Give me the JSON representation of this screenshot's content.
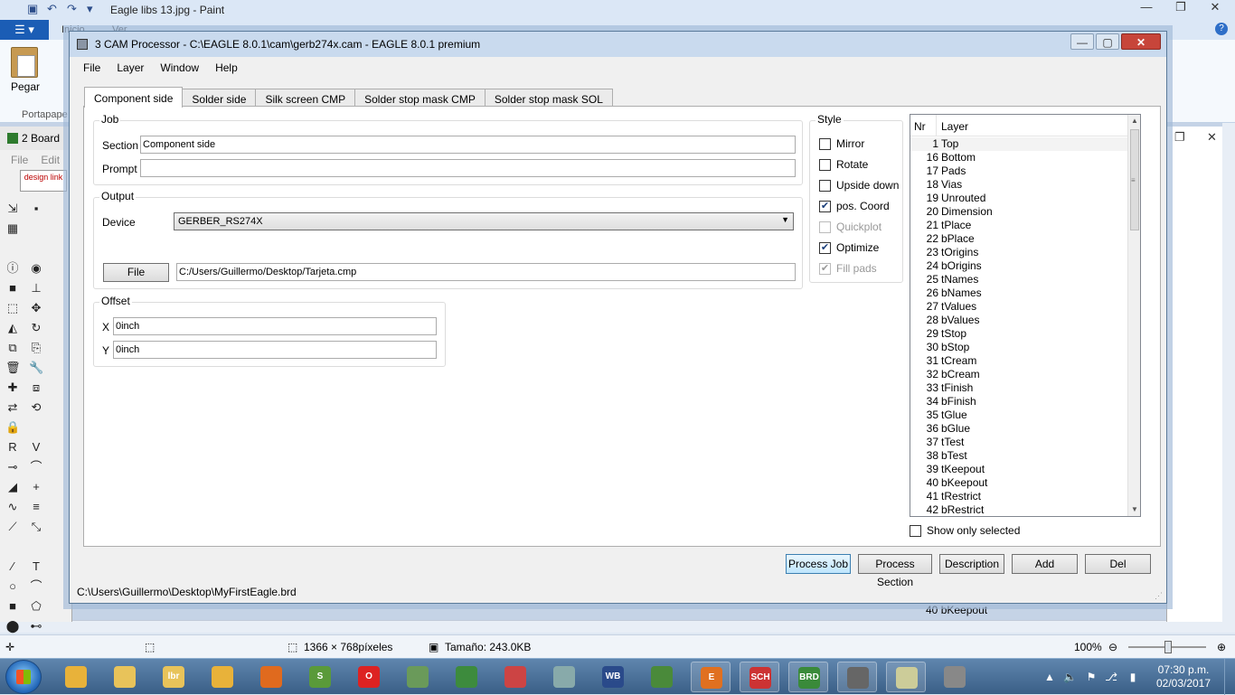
{
  "paint": {
    "title": "Eagle libs 13.jpg - Paint",
    "tabs": [
      "Inicio",
      "Ver"
    ],
    "paste_label": "Pegar",
    "clipboard_label": "Portapape",
    "status": {
      "dimensions": "1366 × 768píxeles",
      "size": "Tamaño: 243.0KB",
      "zoom": "100%"
    }
  },
  "board": {
    "title": "2 Board",
    "menu": [
      "File",
      "Edit"
    ],
    "design_link": "design link",
    "bottom_row_nr": "40",
    "bottom_row_name": "bKeepout"
  },
  "cam": {
    "title": "3 CAM Processor - C:\\EAGLE 8.0.1\\cam\\gerb274x.cam - EAGLE 8.0.1 premium",
    "menu": [
      "File",
      "Layer",
      "Window",
      "Help"
    ],
    "tabs": [
      {
        "label": "Component side",
        "active": true
      },
      {
        "label": "Solder side",
        "active": false
      },
      {
        "label": "Silk screen CMP",
        "active": false
      },
      {
        "label": "Solder stop mask CMP",
        "active": false
      },
      {
        "label": "Solder stop mask SOL",
        "active": false
      }
    ],
    "job": {
      "title": "Job",
      "section_label": "Section",
      "section_value": "Component side",
      "prompt_label": "Prompt",
      "prompt_value": ""
    },
    "output": {
      "title": "Output",
      "device_label": "Device",
      "device_value": "GERBER_RS274X",
      "file_button": "File",
      "file_value": "C:/Users/Guillermo/Desktop/Tarjeta.cmp"
    },
    "offset": {
      "title": "Offset",
      "x_label": "X",
      "x_value": "0inch",
      "y_label": "Y",
      "y_value": "0inch"
    },
    "style": {
      "title": "Style",
      "options": [
        {
          "label": "Mirror",
          "checked": false,
          "disabled": false
        },
        {
          "label": "Rotate",
          "checked": false,
          "disabled": false
        },
        {
          "label": "Upside down",
          "checked": false,
          "disabled": false
        },
        {
          "label": "pos. Coord",
          "checked": true,
          "disabled": false
        },
        {
          "label": "Quickplot",
          "checked": false,
          "disabled": true
        },
        {
          "label": "Optimize",
          "checked": true,
          "disabled": false
        },
        {
          "label": "Fill pads",
          "checked": true,
          "disabled": true
        }
      ]
    },
    "layers": {
      "col_nr": "Nr",
      "col_layer": "Layer",
      "rows": [
        {
          "nr": "1",
          "name": "Top"
        },
        {
          "nr": "16",
          "name": "Bottom"
        },
        {
          "nr": "17",
          "name": "Pads"
        },
        {
          "nr": "18",
          "name": "Vias"
        },
        {
          "nr": "19",
          "name": "Unrouted"
        },
        {
          "nr": "20",
          "name": "Dimension"
        },
        {
          "nr": "21",
          "name": "tPlace"
        },
        {
          "nr": "22",
          "name": "bPlace"
        },
        {
          "nr": "23",
          "name": "tOrigins"
        },
        {
          "nr": "24",
          "name": "bOrigins"
        },
        {
          "nr": "25",
          "name": "tNames"
        },
        {
          "nr": "26",
          "name": "bNames"
        },
        {
          "nr": "27",
          "name": "tValues"
        },
        {
          "nr": "28",
          "name": "bValues"
        },
        {
          "nr": "29",
          "name": "tStop"
        },
        {
          "nr": "30",
          "name": "bStop"
        },
        {
          "nr": "31",
          "name": "tCream"
        },
        {
          "nr": "32",
          "name": "bCream"
        },
        {
          "nr": "33",
          "name": "tFinish"
        },
        {
          "nr": "34",
          "name": "bFinish"
        },
        {
          "nr": "35",
          "name": "tGlue"
        },
        {
          "nr": "36",
          "name": "bGlue"
        },
        {
          "nr": "37",
          "name": "tTest"
        },
        {
          "nr": "38",
          "name": "bTest"
        },
        {
          "nr": "39",
          "name": "tKeepout"
        },
        {
          "nr": "40",
          "name": "bKeepout"
        },
        {
          "nr": "41",
          "name": "tRestrict"
        },
        {
          "nr": "42",
          "name": "bRestrict"
        }
      ],
      "show_only_selected": "Show only selected"
    },
    "buttons": {
      "process_job": "Process Job",
      "process_section": "Process Section",
      "description": "Description",
      "add": "Add",
      "del": "Del"
    },
    "status_path": "C:\\Users\\Guillermo\\Desktop\\MyFirstEagle.brd"
  },
  "taskbar": {
    "apps": [
      "Downloads",
      "Folder",
      "lbr",
      "Downloads",
      "Firefox",
      "Sharp",
      "Opera",
      "Game",
      "Chrome",
      "App",
      "Snipping",
      "WB",
      "j...",
      "E",
      "SCH",
      "BRD",
      "Camera",
      "Paint",
      "Route"
    ],
    "clock_time": "07:30 p.m.",
    "clock_date": "02/03/2017"
  },
  "colors": {
    "cam_titlebar": "#c9daee",
    "taskbar": "#3a5f86",
    "close_button": "#c7453a",
    "paint_file_tab": "#1b5db5"
  }
}
